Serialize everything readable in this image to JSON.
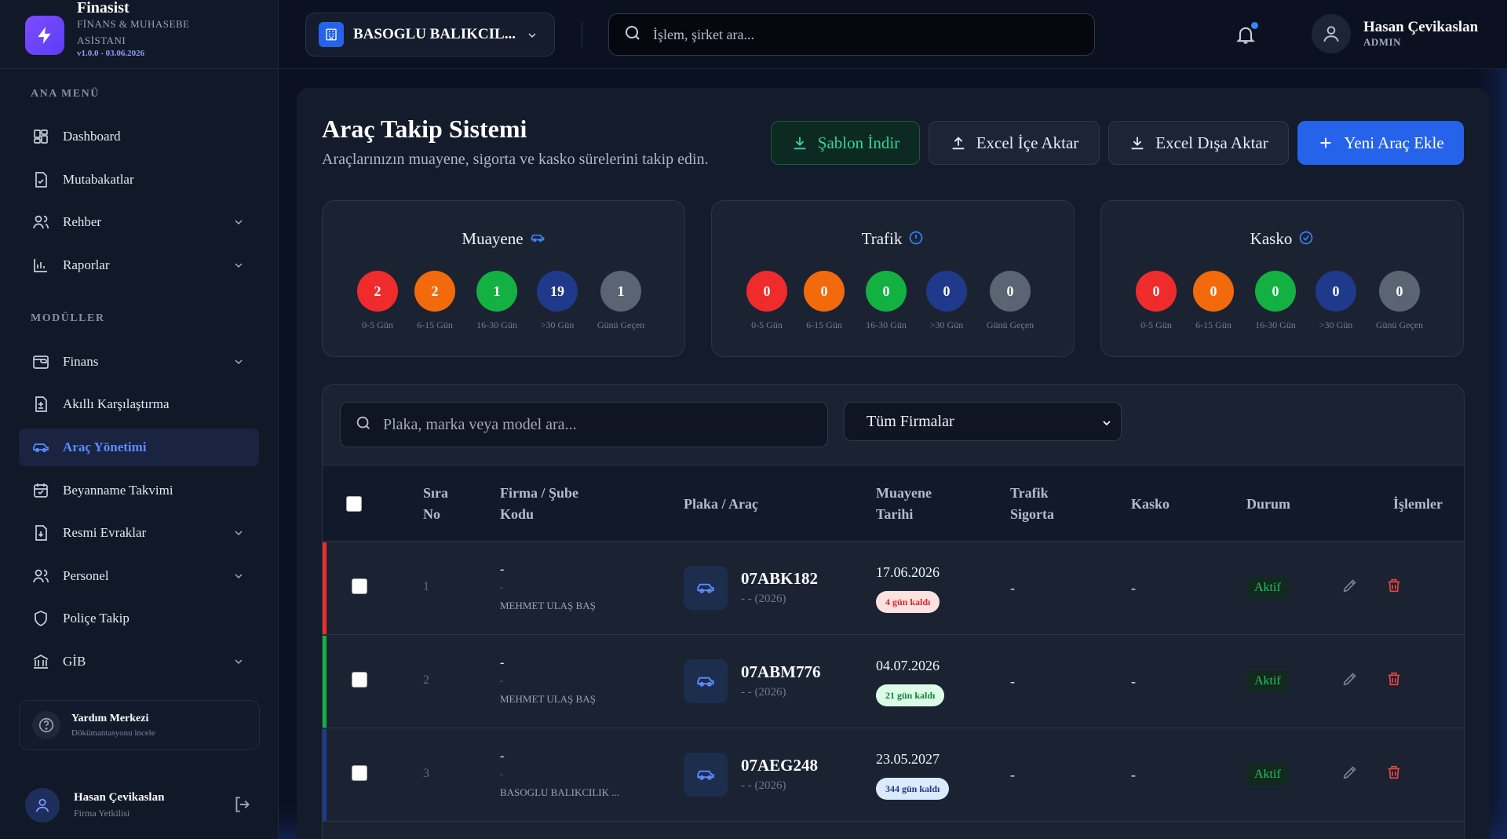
{
  "brand": {
    "name": "Finasist",
    "subtitle_line1": "FİNANS & MUHASEBE",
    "subtitle_line2": "ASİSTANI",
    "version": "v1.0.0 - 03.06.2026"
  },
  "sidebar": {
    "section_main": "ANA MENÜ",
    "section_modules": "MODÜLLER",
    "items": [
      {
        "label": "Dashboard",
        "icon": "dashboard-grid-icon",
        "expandable": false
      },
      {
        "label": "Mutabakatlar",
        "icon": "document-check-icon",
        "expandable": false
      },
      {
        "label": "Rehber",
        "icon": "users-icon",
        "expandable": true
      },
      {
        "label": "Raporlar",
        "icon": "bar-chart-icon",
        "expandable": true
      },
      {
        "label": "Finans",
        "icon": "wallet-icon",
        "expandable": true
      },
      {
        "label": "Akıllı Karşılaştırma",
        "icon": "compare-document-icon",
        "expandable": false
      },
      {
        "label": "Araç Yönetimi",
        "icon": "car-icon",
        "expandable": false,
        "active": true
      },
      {
        "label": "Beyanname Takvimi",
        "icon": "calendar-icon",
        "expandable": false
      },
      {
        "label": "Resmi Evraklar",
        "icon": "document-download-icon",
        "expandable": true
      },
      {
        "label": "Personel",
        "icon": "users-icon",
        "expandable": true
      },
      {
        "label": "Poliçe Takip",
        "icon": "shield-icon",
        "expandable": false
      },
      {
        "label": "GİB",
        "icon": "bank-icon",
        "expandable": true
      }
    ],
    "help": {
      "title": "Yardım Merkezi",
      "subtitle": "Dökümantasyonu incele"
    },
    "user": {
      "name": "Hasan Çevikaslan",
      "role": "Firma Yetkilisi"
    }
  },
  "topbar": {
    "company": "BASOGLU BALIKCIL...",
    "search_placeholder": "İşlem, şirket ara...",
    "user_name": "Hasan Çevikaslan",
    "user_role": "ADMIN"
  },
  "page": {
    "title": "Araç Takip Sistemi",
    "subtitle": "Araçlarınızın muayene, sigorta ve kasko sürelerini takip edin.",
    "buttons": {
      "template": "Şablon İndir",
      "import": "Excel İçe Aktar",
      "export": "Excel Dışa Aktar",
      "add": "Yeni Araç Ekle"
    }
  },
  "stats": {
    "labels": [
      "0-5 Gün",
      "6-15 Gün",
      "16-30 Gün",
      ">30 Gün",
      "Günü Geçen"
    ],
    "colors": [
      "#ef2b2b",
      "#f26a0c",
      "#13b141",
      "#1f3a8a",
      "#5b6472"
    ],
    "cards": [
      {
        "title": "Muayene",
        "values": [
          "2",
          "2",
          "1",
          "19",
          "1"
        ]
      },
      {
        "title": "Trafik",
        "values": [
          "0",
          "0",
          "0",
          "0",
          "0"
        ]
      },
      {
        "title": "Kasko",
        "values": [
          "0",
          "0",
          "0",
          "0",
          "0"
        ]
      }
    ]
  },
  "table": {
    "search_placeholder": "Plaka, marka veya model ara...",
    "filter_value": "Tüm Firmalar",
    "headers": {
      "seq_1": "Sıra",
      "seq_2": "No",
      "firm_1": "Firma / Şube",
      "firm_2": "Kodu",
      "plate": "Plaka / Araç",
      "insp_1": "Muayene",
      "insp_2": "Tarihi",
      "traffic_1": "Trafik",
      "traffic_2": "Sigorta",
      "kasko": "Kasko",
      "status": "Durum",
      "actions": "İşlemler"
    },
    "rows": [
      {
        "seq": "1",
        "firm": "-",
        "branch": "-",
        "owner": "MEHMET ULAŞ BAŞ",
        "plate": "07ABK182",
        "sub": "- - (2026)",
        "date": "17.06.2026",
        "remaining": "4 gün kaldı",
        "traffic": "-",
        "kasko": "-",
        "status": "Aktif",
        "accent": "#ef2b2b",
        "pill_bg": "#fde2e2",
        "pill_fg": "#dc2626"
      },
      {
        "seq": "2",
        "firm": "-",
        "branch": "-",
        "owner": "MEHMET ULAŞ BAŞ",
        "plate": "07ABM776",
        "sub": "- - (2026)",
        "date": "04.07.2026",
        "remaining": "21 gün kaldı",
        "traffic": "-",
        "kasko": "-",
        "status": "Aktif",
        "accent": "#13b141",
        "pill_bg": "#dcfce7",
        "pill_fg": "#15803d"
      },
      {
        "seq": "3",
        "firm": "-",
        "branch": "-",
        "owner": "BASOGLU BALIKCILIK ...",
        "plate": "07AEG248",
        "sub": "- - (2026)",
        "date": "23.05.2027",
        "remaining": "344 gün kaldı",
        "traffic": "-",
        "kasko": "-",
        "status": "Aktif",
        "accent": "#1f3a8a",
        "pill_bg": "#dbeafe",
        "pill_fg": "#1e3a8a"
      }
    ]
  }
}
